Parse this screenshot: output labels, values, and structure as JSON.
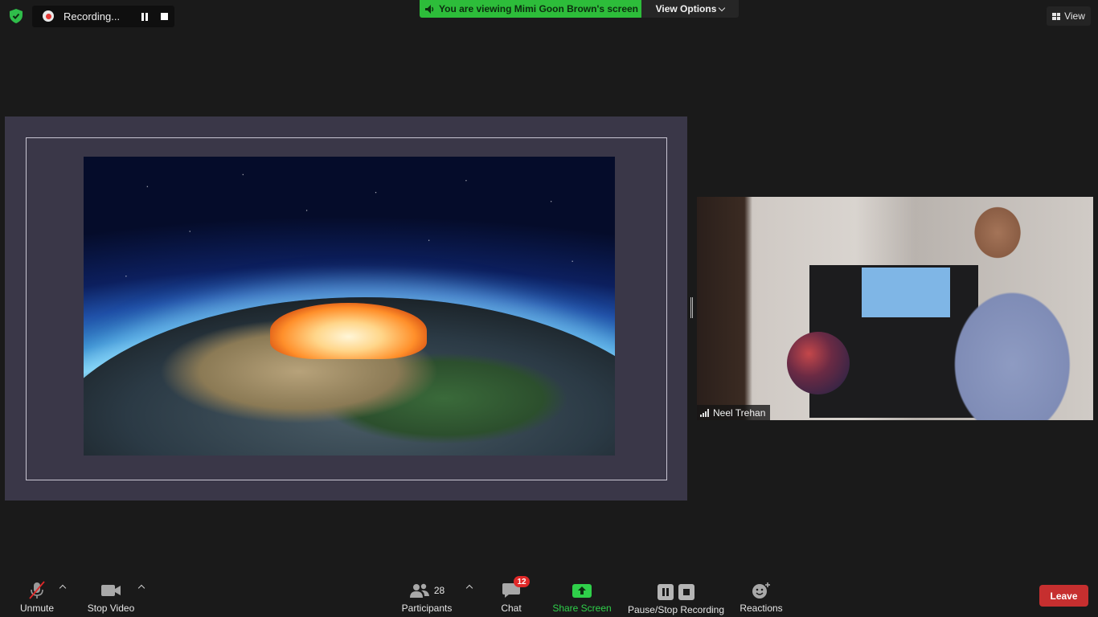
{
  "recording": {
    "label": "Recording..."
  },
  "banner": {
    "viewing_text": "You are viewing Mimi Goon Brown's screen",
    "view_options_label": "View Options"
  },
  "top_right": {
    "view_label": "View"
  },
  "participant_video": {
    "name": "Neel Trehan"
  },
  "toolbar": {
    "unmute_label": "Unmute",
    "stop_video_label": "Stop Video",
    "participants_label": "Participants",
    "participants_count": "28",
    "chat_label": "Chat",
    "chat_badge": "12",
    "share_screen_label": "Share Screen",
    "pause_stop_recording_label": "Pause/Stop Recording",
    "reactions_label": "Reactions",
    "leave_label": "Leave"
  },
  "colors": {
    "background": "#1a1a1a",
    "share_banner_green": "#2dbd3a",
    "share_screen_green": "#2fd04a",
    "leave_red": "#c62f2f",
    "badge_red": "#e02828",
    "slide_background": "#3a3748"
  },
  "icons": {
    "security": "shield-check-icon",
    "record": "record-dot-icon",
    "pause": "pause-icon",
    "stop": "stop-icon",
    "speaker": "speaker-icon",
    "view": "grid-icon",
    "mic": "microphone-muted-icon",
    "camera": "video-camera-icon",
    "participants": "people-icon",
    "chat": "chat-bubble-icon",
    "share": "share-arrow-icon",
    "reactions": "emoji-plus-icon",
    "signal": "signal-bars-icon"
  }
}
